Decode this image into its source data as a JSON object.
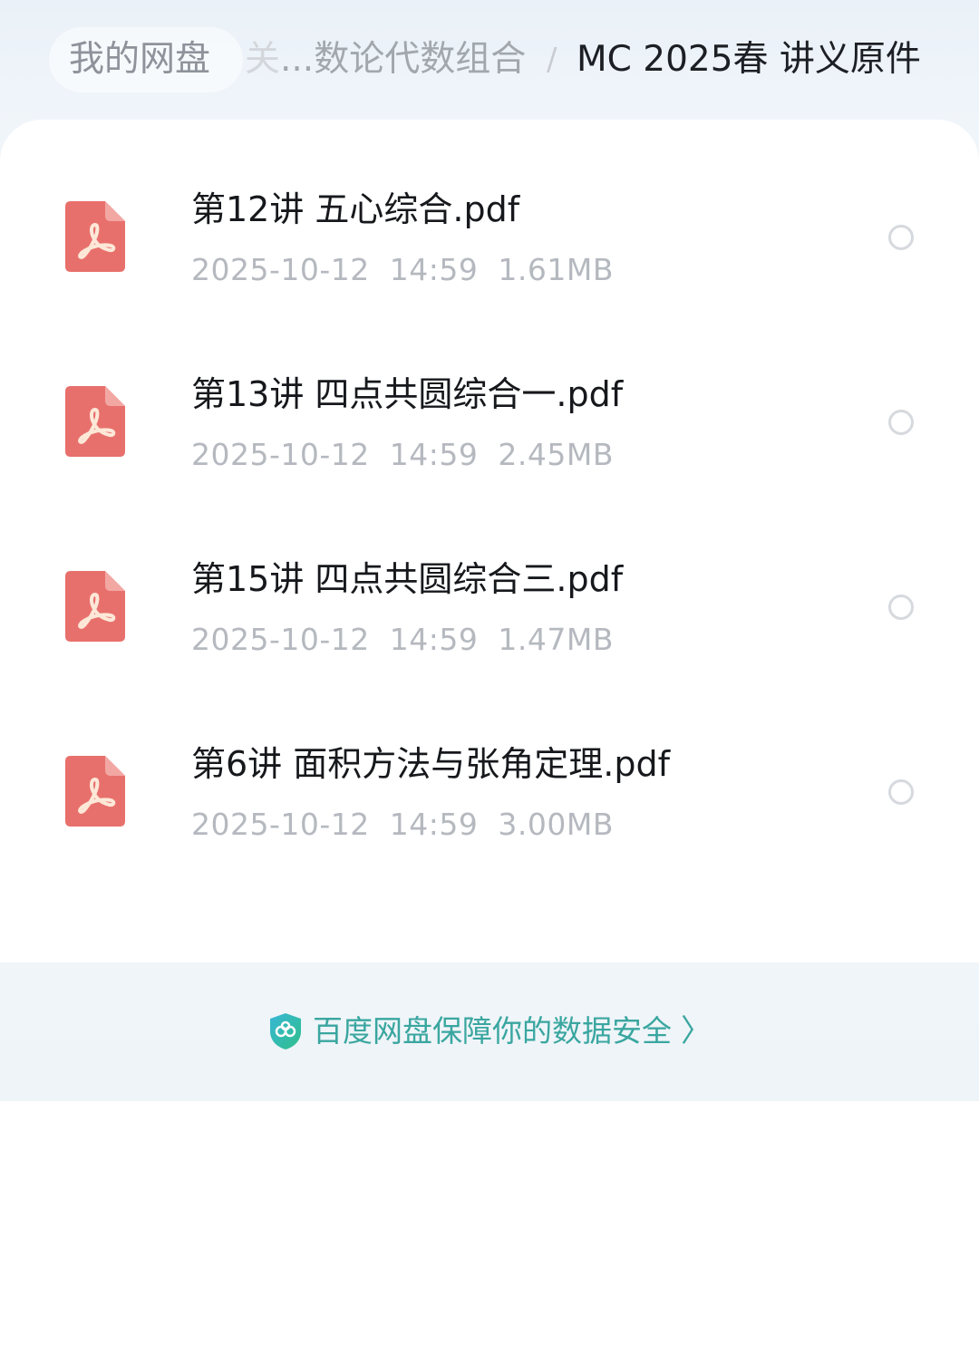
{
  "breadcrumb": {
    "root": "我的网盘",
    "middle_faded": "关",
    "middle": "...数论代数组合",
    "separator": "/",
    "current": "MC 2025春 讲义原件"
  },
  "files": [
    {
      "name": "第12讲 五心综合.pdf",
      "date": "2025-10-12",
      "time": "14:59",
      "size": "1.61MB",
      "icon": "pdf-icon"
    },
    {
      "name": "第13讲 四点共圆综合一.pdf",
      "date": "2025-10-12",
      "time": "14:59",
      "size": "2.45MB",
      "icon": "pdf-icon"
    },
    {
      "name": "第15讲 四点共圆综合三.pdf",
      "date": "2025-10-12",
      "time": "14:59",
      "size": "1.47MB",
      "icon": "pdf-icon"
    },
    {
      "name": "第6讲 面积方法与张角定理.pdf",
      "date": "2025-10-12",
      "time": "14:59",
      "size": "3.00MB",
      "icon": "pdf-icon"
    }
  ],
  "footer": {
    "safety_text": "百度网盘保障你的数据安全",
    "chevron": "〉",
    "icon": "shield-icon"
  },
  "colors": {
    "pdf_icon": "#e8706c",
    "accent_teal": "#3aa6a0",
    "meta_gray": "#b5b9bf"
  }
}
